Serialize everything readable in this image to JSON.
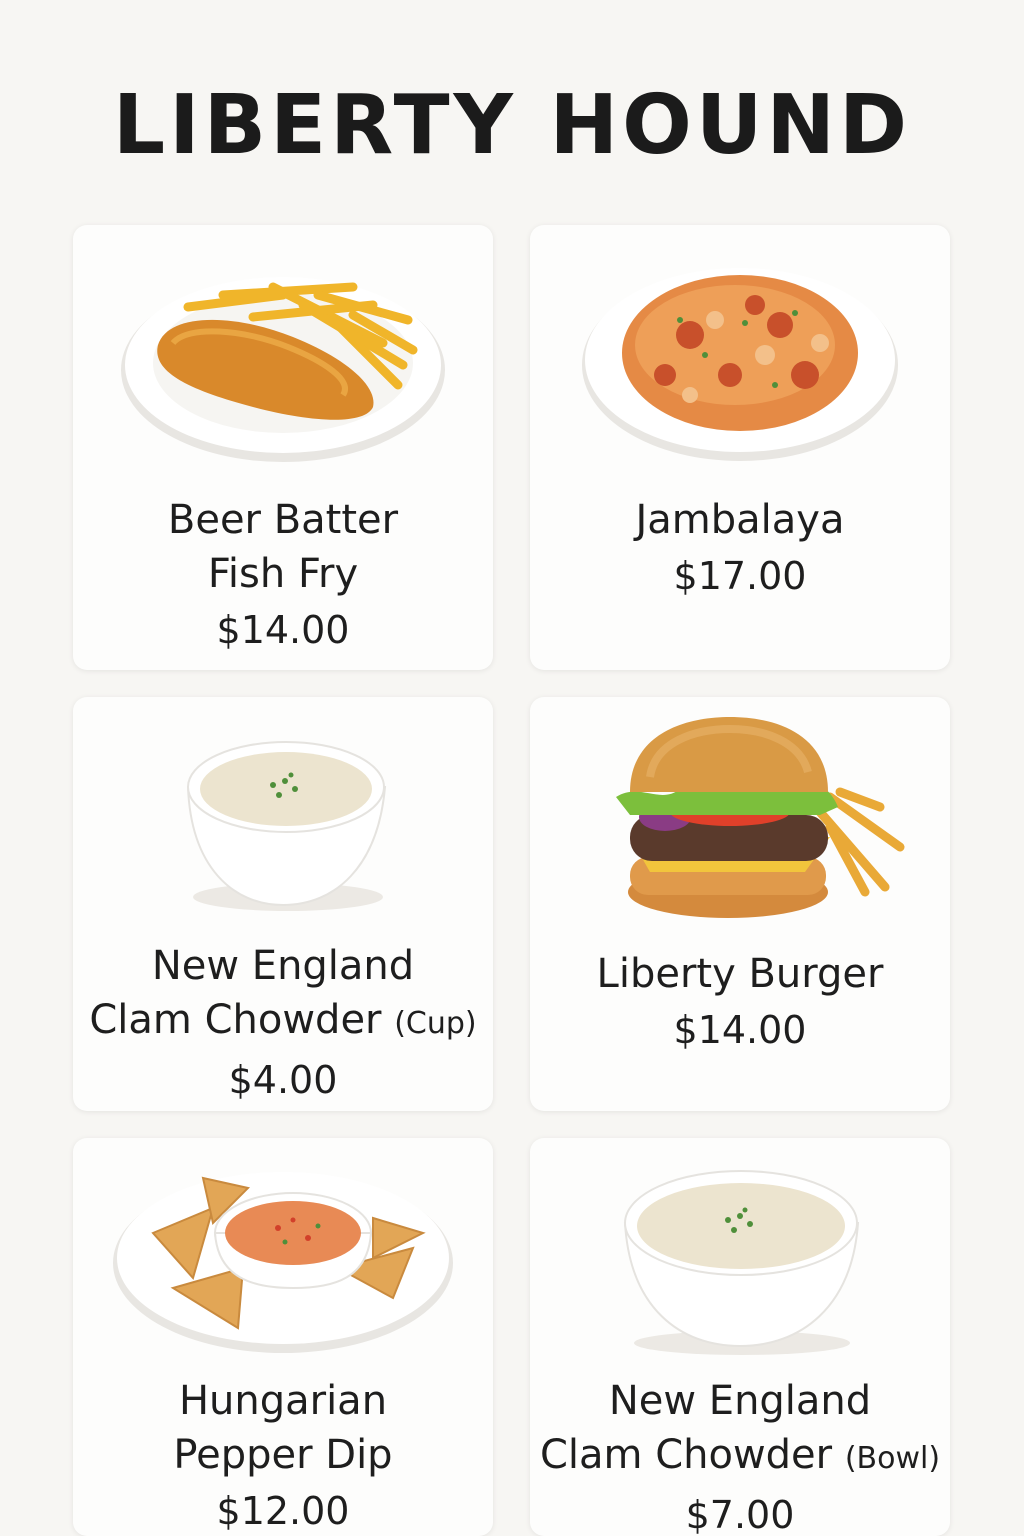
{
  "menu": {
    "title": "LIBERTY HOUND",
    "items": [
      {
        "name_line1": "Beer Batter",
        "name_line2": "Fish Fry",
        "name_suffix": "",
        "price": "$14.00",
        "image": "fish-fry-plate"
      },
      {
        "name_line1": "Jambalaya",
        "name_line2": "",
        "name_suffix": "",
        "price": "$17.00",
        "image": "jambalaya-plate"
      },
      {
        "name_line1": "New England",
        "name_line2": "Clam Chowder",
        "name_suffix": "(Cup)",
        "price": "$4.00",
        "image": "chowder-cup"
      },
      {
        "name_line1": "Liberty Burger",
        "name_line2": "",
        "name_suffix": "",
        "price": "$14.00",
        "image": "burger-with-fries"
      },
      {
        "name_line1": "Hungarian",
        "name_line2": "Pepper Dip",
        "name_suffix": "",
        "price": "$12.00",
        "image": "pepper-dip-plate"
      },
      {
        "name_line1": "New England",
        "name_line2": "Clam Chowder",
        "name_suffix": "(Bowl)",
        "price": "$7.00",
        "image": "chowder-bowl"
      }
    ]
  },
  "colors": {
    "background": "#f7f6f3",
    "card": "#fdfdfc",
    "text": "#1e1e1e"
  }
}
